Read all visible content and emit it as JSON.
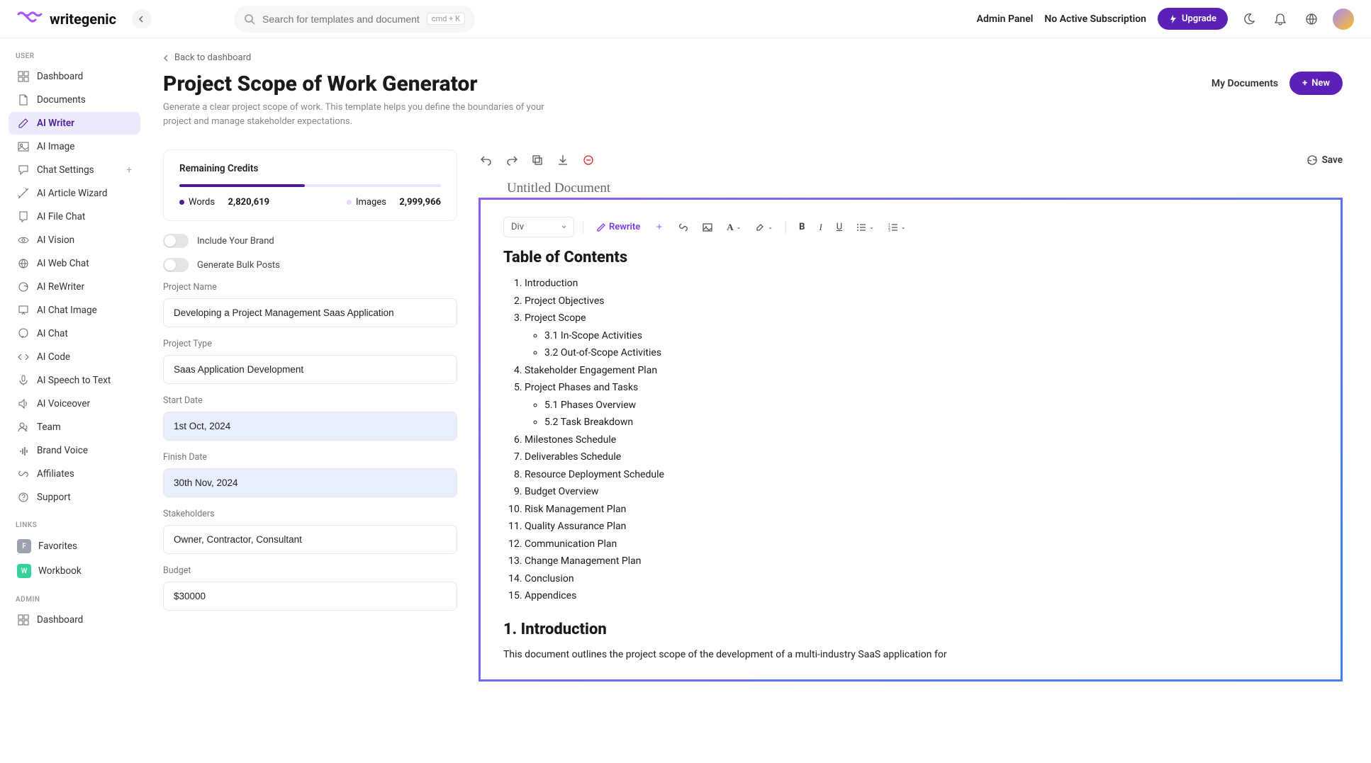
{
  "brand": {
    "name": "writegenic"
  },
  "search": {
    "placeholder": "Search for templates and documents...",
    "kbd": "cmd  +  K"
  },
  "top": {
    "admin_panel": "Admin Panel",
    "no_sub": "No Active Subscription",
    "upgrade": "Upgrade"
  },
  "sidebar": {
    "section_user": "USER",
    "section_links": "LINKS",
    "section_admin": "ADMIN",
    "items": [
      {
        "label": "Dashboard",
        "icon": "grid"
      },
      {
        "label": "Documents",
        "icon": "file"
      },
      {
        "label": "AI Writer",
        "icon": "pen",
        "active": true
      },
      {
        "label": "AI Image",
        "icon": "image"
      },
      {
        "label": "Chat Settings",
        "icon": "chat",
        "plus": true
      },
      {
        "label": "AI Article Wizard",
        "icon": "wand"
      },
      {
        "label": "AI File Chat",
        "icon": "filechat"
      },
      {
        "label": "AI Vision",
        "icon": "eye"
      },
      {
        "label": "AI Web Chat",
        "icon": "globe"
      },
      {
        "label": "AI ReWriter",
        "icon": "refresh"
      },
      {
        "label": "AI Chat Image",
        "icon": "chatimg"
      },
      {
        "label": "AI Chat",
        "icon": "chat2"
      },
      {
        "label": "AI Code",
        "icon": "code"
      },
      {
        "label": "AI Speech to Text",
        "icon": "mic"
      },
      {
        "label": "AI Voiceover",
        "icon": "speaker"
      },
      {
        "label": "Team",
        "icon": "users"
      },
      {
        "label": "Brand Voice",
        "icon": "voice"
      },
      {
        "label": "Affiliates",
        "icon": "link"
      },
      {
        "label": "Support",
        "icon": "help"
      }
    ],
    "links": [
      {
        "label": "Favorites",
        "badge": "F",
        "color": "#9ca3af"
      },
      {
        "label": "Workbook",
        "badge": "W",
        "color": "#34d399"
      }
    ],
    "admin": [
      {
        "label": "Dashboard",
        "icon": "grid"
      }
    ]
  },
  "page": {
    "back": "Back to dashboard",
    "title": "Project Scope of Work Generator",
    "subtitle": "Generate a clear project scope of work. This template helps you define the boundaries of your project and manage stakeholder expectations.",
    "my_docs": "My Documents",
    "new": "New"
  },
  "credits": {
    "heading": "Remaining Credits",
    "words_label": "Words",
    "words_value": "2,820,619",
    "images_label": "Images",
    "images_value": "2,999,966"
  },
  "form": {
    "toggle1": "Include Your Brand",
    "toggle2": "Generate Bulk Posts",
    "fields": {
      "project_name": {
        "label": "Project Name",
        "value": "Developing a Project Management Saas Application"
      },
      "project_type": {
        "label": "Project Type",
        "value": "Saas Application Development"
      },
      "start_date": {
        "label": "Start Date",
        "value": "1st Oct, 2024"
      },
      "finish_date": {
        "label": "Finish Date",
        "value": "30th Nov, 2024"
      },
      "stakeholders": {
        "label": "Stakeholders",
        "value": "Owner, Contractor, Consultant"
      },
      "budget": {
        "label": "Budget",
        "value": "$30000"
      }
    }
  },
  "editor": {
    "doc_title": "Untitled Document",
    "save": "Save",
    "block_type": "Div",
    "rewrite": "Rewrite",
    "content": {
      "toc_heading": "Table of Contents",
      "toc": [
        "Introduction",
        "Project Objectives",
        "Project Scope",
        "Stakeholder Engagement Plan",
        "Project Phases and Tasks",
        "Milestones Schedule",
        "Deliverables Schedule",
        "Resource Deployment Schedule",
        "Budget Overview",
        "Risk Management Plan",
        "Quality Assurance Plan",
        "Communication Plan",
        "Change Management Plan",
        "Conclusion",
        "Appendices"
      ],
      "toc_sub3": [
        "3.1 In-Scope Activities",
        "3.2 Out-of-Scope Activities"
      ],
      "toc_sub5": [
        "5.1 Phases Overview",
        "5.2 Task Breakdown"
      ],
      "section1_h": "1. Introduction",
      "section1_p": "This document outlines the project scope of the development of a multi-industry SaaS application for"
    }
  }
}
